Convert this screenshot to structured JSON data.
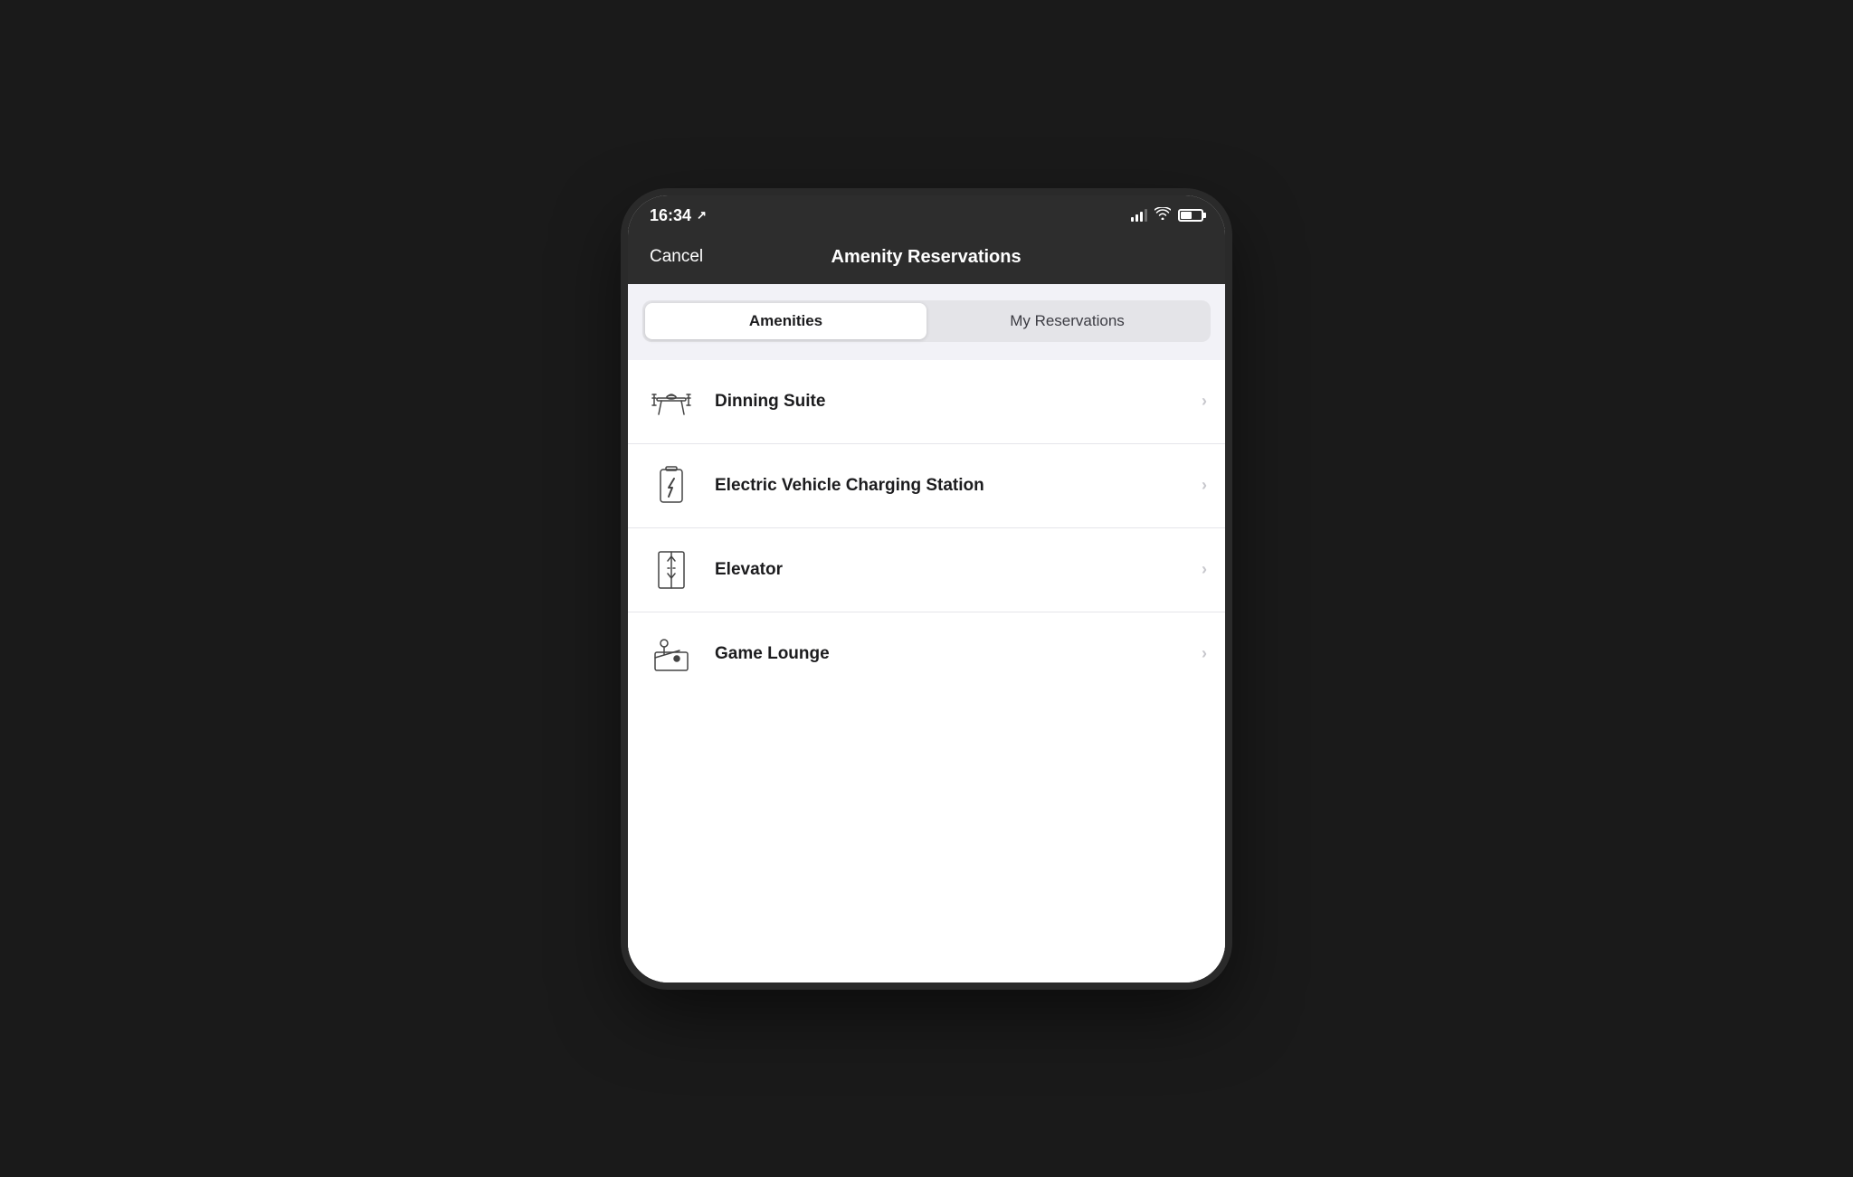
{
  "statusBar": {
    "time": "16:34",
    "locationArrow": "⟩",
    "wifiSymbol": "WiFi",
    "batteryLevel": 55
  },
  "navBar": {
    "cancelLabel": "Cancel",
    "title": "Amenity Reservations"
  },
  "segmentedControl": {
    "tabs": [
      {
        "id": "amenities",
        "label": "Amenities",
        "active": true
      },
      {
        "id": "my-reservations",
        "label": "My Reservations",
        "active": false
      }
    ]
  },
  "listItems": [
    {
      "id": "dining-suite",
      "label": "Dinning Suite",
      "iconName": "dining-icon"
    },
    {
      "id": "ev-charging",
      "label": "Electric Vehicle Charging Station",
      "iconName": "ev-charging-icon"
    },
    {
      "id": "elevator",
      "label": "Elevator",
      "iconName": "elevator-icon"
    },
    {
      "id": "game-lounge",
      "label": "Game Lounge",
      "iconName": "game-lounge-icon"
    }
  ],
  "chevronSymbol": "›"
}
